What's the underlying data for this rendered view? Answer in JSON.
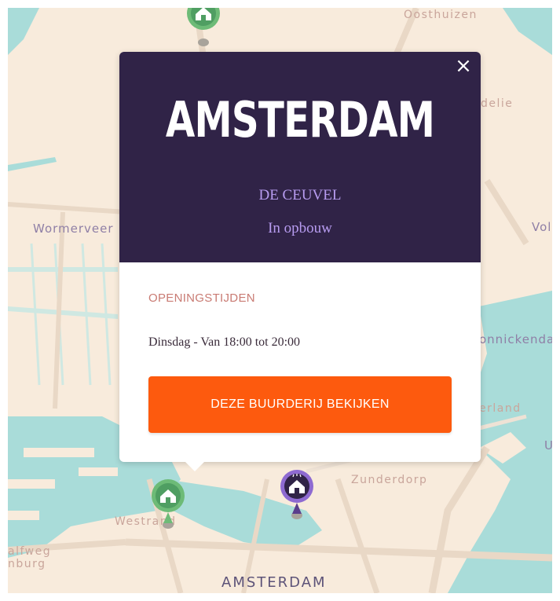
{
  "map": {
    "labels": {
      "oosthuizen": "Oosthuizen",
      "edelie": "delie",
      "wormerveer": "Wormerveer",
      "volendam": "Vol",
      "monnickendam": "onnickenda",
      "waterland": "erland",
      "zunderdorp": "Zunderdorp",
      "westrand": "Westrand",
      "halfweg": "alfweg",
      "zwanenburg": "nburg",
      "u_letter": "U",
      "amsterdam": "AMSTERDAM"
    },
    "colors": {
      "land": "#f8ebdc",
      "water": "#a9dcd9",
      "road": "#e9d8c6",
      "green_pin": "#6dbb77",
      "purple_pin": "#5a3e8c"
    },
    "pins": [
      {
        "type": "farm",
        "status": "active",
        "icon": "barn-icon",
        "color": "green"
      },
      {
        "type": "farm",
        "status": "active",
        "icon": "barn-icon",
        "color": "green"
      },
      {
        "type": "farm",
        "status": "selected",
        "icon": "barn-icon",
        "color": "purple"
      }
    ]
  },
  "popup": {
    "close_label": "×",
    "city": "AMSTERDAM",
    "farm_name": "DE CEUVEL",
    "status": "In opbouw",
    "hours_heading": "OPENINGSTIJDEN",
    "hours_text": "Dinsdag - Van 18:00 tot 20:00",
    "cta_label": "DEZE BUURDERIJ BEKIJKEN",
    "colors": {
      "header_bg": "#302347",
      "accent": "#b79cf0",
      "heading": "#c97b73",
      "button": "#fd5a0e"
    }
  }
}
